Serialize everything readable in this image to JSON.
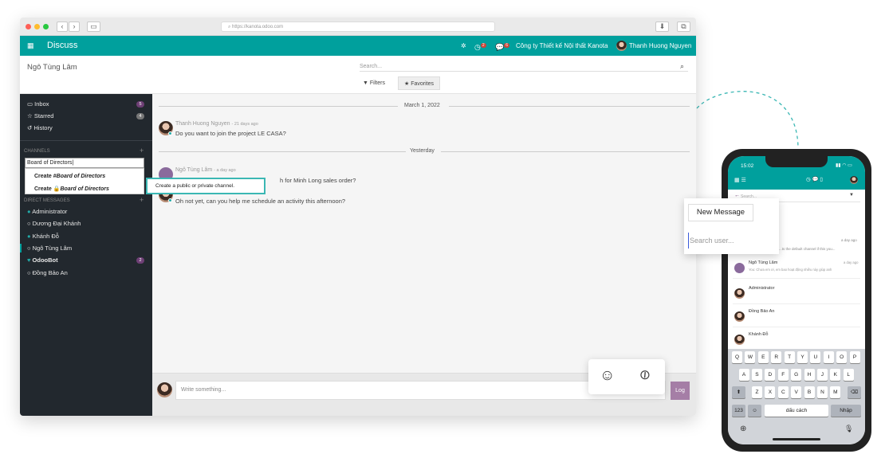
{
  "browser": {
    "url": "https://kanota.odoo.com",
    "app_title": "Discuss",
    "company": "Công ty Thiết kế Nội thất Kanota",
    "user": "Thanh Huong Nguyen",
    "activity_count": "2",
    "message_count": "6"
  },
  "cpanel": {
    "breadcrumb": "Ngô Tùng Lâm",
    "search_placeholder": "Search...",
    "filters_label": "Filters",
    "favorites_label": "Favorites"
  },
  "sidebar": {
    "mailboxes": [
      {
        "label": "Inbox",
        "count": "5"
      },
      {
        "label": "Starred",
        "count": "4"
      },
      {
        "label": "History"
      }
    ],
    "channels_header": "CHANNELS",
    "channel_input_value": "Board of Directors",
    "autocomplete": {
      "prefix1": "Create #",
      "name1": "Board of Directors",
      "prefix2": "Create ",
      "name2": "Board of Directors"
    },
    "tooltip": "Create a public or private channel.",
    "dm_header": "DIRECT MESSAGES",
    "dms": [
      {
        "label": "Administrator",
        "status": "online"
      },
      {
        "label": "Dương Đại Khánh",
        "status": "offline"
      },
      {
        "label": "Khánh Đỗ",
        "status": "online"
      },
      {
        "label": "Ngô Tùng Lâm",
        "status": "offline"
      },
      {
        "label": "OdooBot",
        "status": "bot",
        "count": "2"
      },
      {
        "label": "Đồng Bảo An",
        "status": "offline"
      }
    ]
  },
  "thread": {
    "date1": "March 1, 2022",
    "msg1_author": "Thanh Huong Nguyen",
    "msg1_time": "- 21 days ago",
    "msg1_text": "Do you want to join the project LE CASA?",
    "date2": "Yesterday",
    "msg2_author": "Ngô Tùng Lâm",
    "msg2_time": "- a day ago",
    "msg2_text_tail": "h for Minh Long sales order?",
    "msg3_text": "Oh not yet, can you help me schedule an activity this afternoon?"
  },
  "composer": {
    "placeholder": "Write something...",
    "log_label": "Log"
  },
  "phone": {
    "time": "15:02",
    "search_placeholder": "Search...",
    "new_message_label": "New Message",
    "search_user_placeholder": "Search user...",
    "snippet_time": "a day ago",
    "snippet_text": "...ts the default channel if this you...",
    "contacts": [
      {
        "name": "Ngô Tùng Lâm",
        "preview": "You: Chưa em ơi, em bao hoạt động nhiều này giúp anh",
        "time": "a day ago"
      },
      {
        "name": "Administrator"
      },
      {
        "name": "Đồng Bảo An"
      },
      {
        "name": "Khánh Đỗ"
      }
    ],
    "keys_row1": [
      "Q",
      "W",
      "E",
      "R",
      "T",
      "Y",
      "U",
      "I",
      "O",
      "P"
    ],
    "keys_row2": [
      "A",
      "S",
      "D",
      "F",
      "G",
      "H",
      "J",
      "K",
      "L"
    ],
    "keys_row3": [
      "Z",
      "X",
      "C",
      "V",
      "B",
      "N",
      "M"
    ],
    "key_123": "123",
    "space_label": "dấu cách",
    "enter_label": "Nhập"
  },
  "colors": {
    "accent": "#00a09d",
    "sidebar": "#22282e",
    "bot": "#6e3f75",
    "log": "#a57ea6"
  }
}
